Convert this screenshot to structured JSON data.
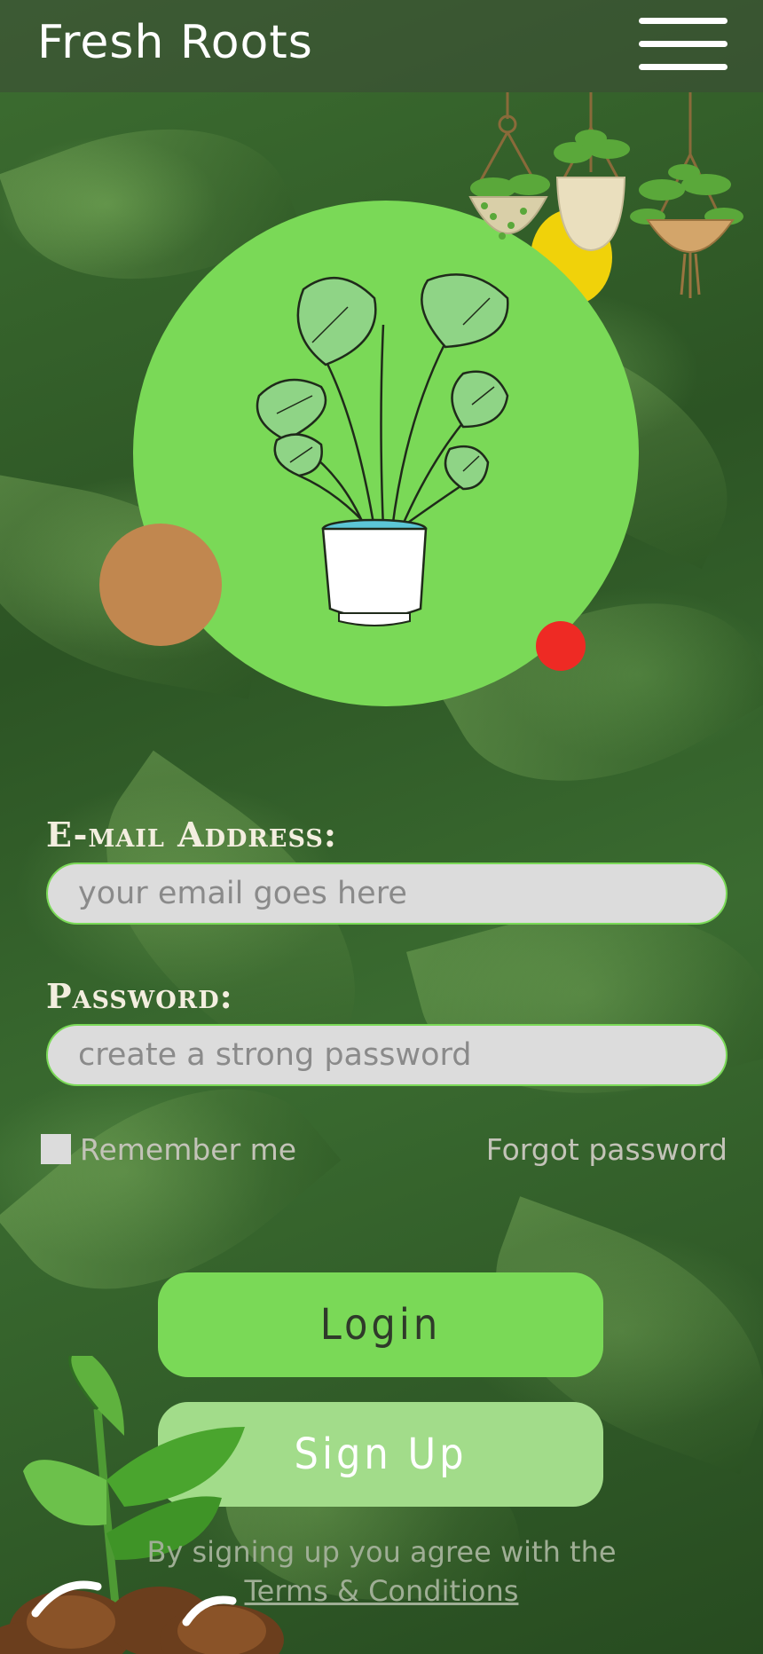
{
  "header": {
    "title": "Fresh Roots",
    "menu_icon": "hamburger-menu-icon"
  },
  "hero": {
    "illustration": "potted-monstera-plant",
    "decor": "hanging-plants",
    "circle_color": "#7ad957"
  },
  "form": {
    "email_label": "E-mail Address:",
    "email_placeholder": "your email goes here",
    "password_label": "Password:",
    "password_placeholder": "create a strong password",
    "remember_label": "Remember me",
    "forgot_label": "Forgot password",
    "login_label": "Login",
    "signup_label": "Sign Up",
    "terms_text": "By signing up you agree with the",
    "terms_link": "Terms & Conditions"
  },
  "colors": {
    "accent": "#7ad957",
    "secondary": "#a2dc8a",
    "field_bg": "#dcdcdc"
  }
}
